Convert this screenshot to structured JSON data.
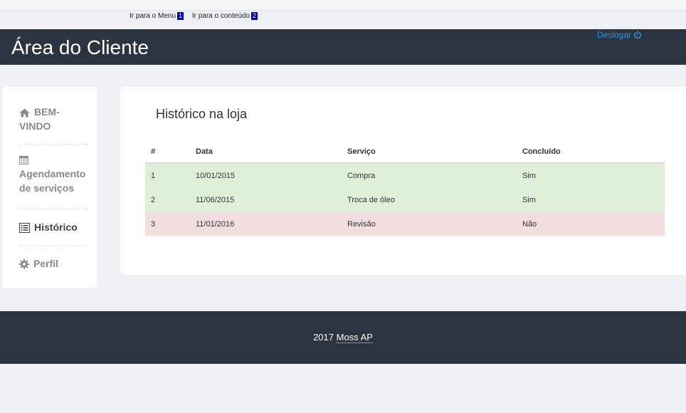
{
  "skip_links": {
    "menu_label": "Ir para o Menu",
    "menu_key": "1",
    "content_label": "Ir para o conteúdo",
    "content_key": "2"
  },
  "header": {
    "title": "Área do Cliente",
    "logout_label": "Deslogar",
    "logout_icon": "power-icon"
  },
  "sidebar": {
    "items": [
      {
        "label": "BEM-VINDO",
        "icon": "home-icon",
        "active": false
      },
      {
        "label": "Agendamento de serviços",
        "icon": "calendar-icon",
        "active": false
      },
      {
        "label": "Histórico",
        "icon": "list-icon",
        "active": true
      },
      {
        "label": "Perfil",
        "icon": "gear-icon",
        "active": false
      }
    ]
  },
  "main": {
    "title": "Histórico na loja",
    "table": {
      "headers": [
        "#",
        "Data",
        "Serviço",
        "Concluído"
      ],
      "rows": [
        {
          "num": "1",
          "data": "10/01/2015",
          "servico": "Compra",
          "concluido": "Sim",
          "status": "success"
        },
        {
          "num": "2",
          "data": "11/06/2015",
          "servico": "Troca de óleo",
          "concluido": "Sim",
          "status": "success"
        },
        {
          "num": "3",
          "data": "11/01/2016",
          "servico": "Revisão",
          "concluido": "Não",
          "status": "danger"
        }
      ]
    }
  },
  "footer": {
    "year": "2017",
    "link": "Moss AP"
  },
  "colors": {
    "header_bg": "#2c3440",
    "link": "#2f93e0",
    "row_success": "#dff0d8",
    "row_danger": "#f2dede"
  }
}
